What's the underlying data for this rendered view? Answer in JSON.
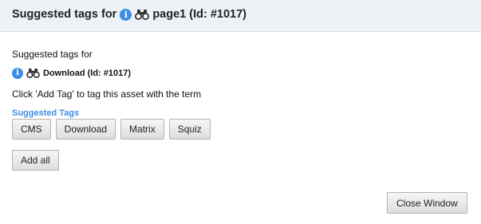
{
  "header": {
    "title_prefix": "Suggested tags for",
    "title_asset": "page1 (Id: #1017)",
    "info_glyph": "i"
  },
  "body": {
    "suggested_for": "Suggested tags for",
    "asset_name": "Download (Id: #1017)",
    "info_glyph": "i",
    "instruction": "Click 'Add Tag' to tag this asset with the term"
  },
  "tags": {
    "label": "Suggested Tags",
    "items": [
      "CMS",
      "Download",
      "Matrix",
      "Squiz"
    ]
  },
  "actions": {
    "add_all": "Add all",
    "close_window": "Close Window"
  },
  "colors": {
    "accent": "#3d8ee6",
    "header_bg": "#eef2f7"
  },
  "icons": {
    "info": "info-icon",
    "asset": "binoculars-icon"
  }
}
